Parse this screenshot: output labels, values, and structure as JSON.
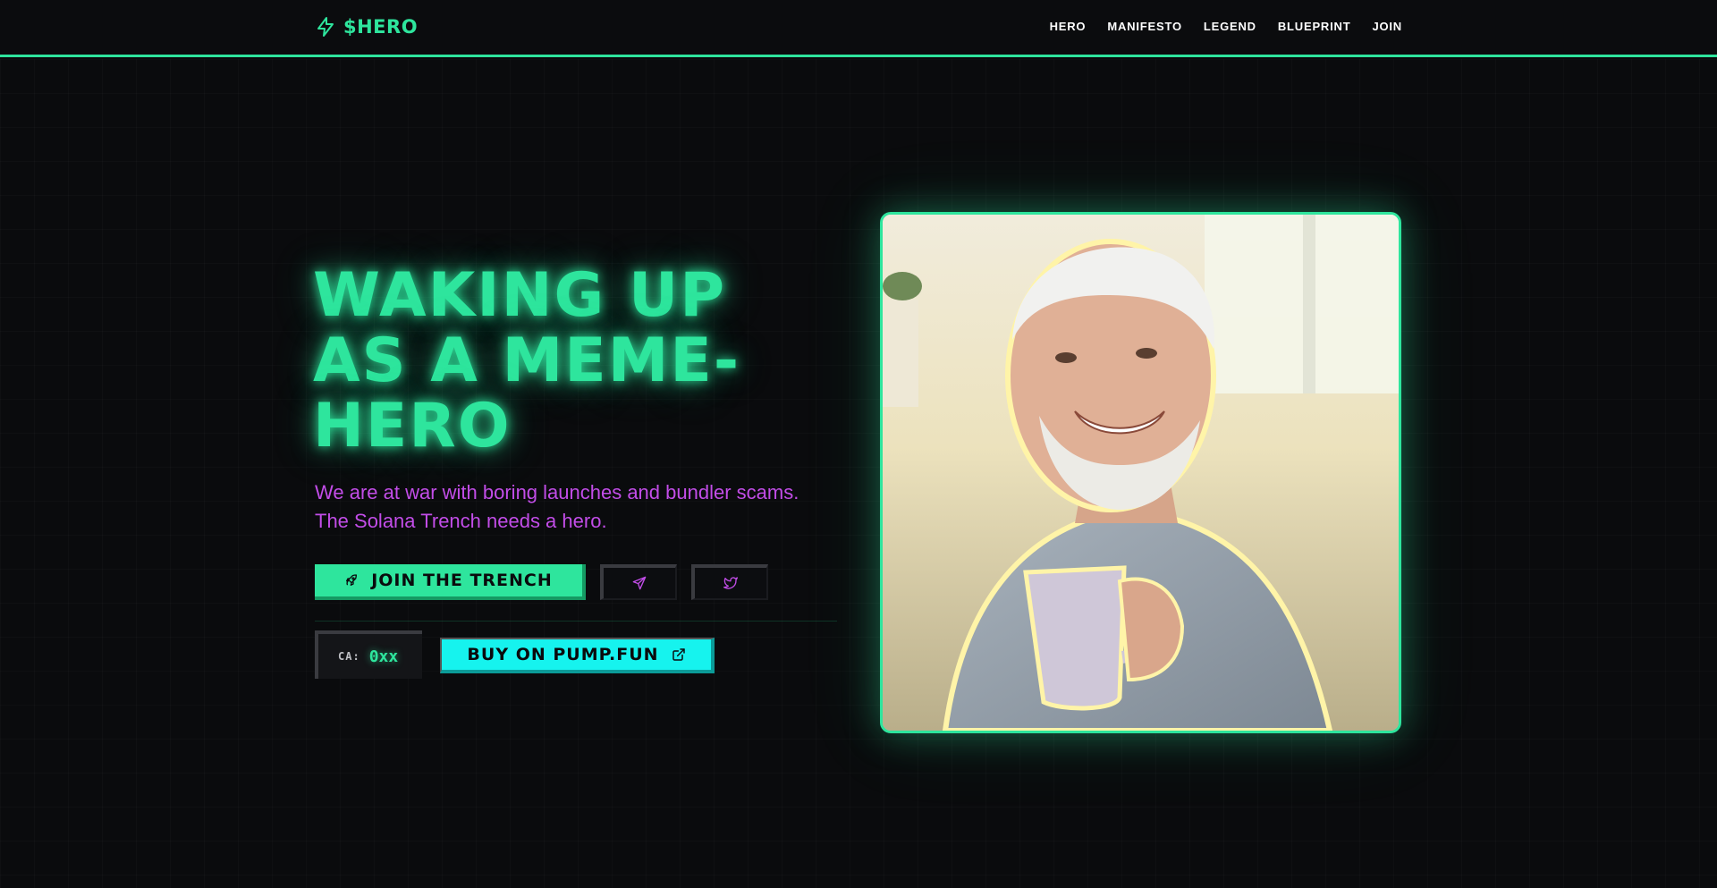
{
  "header": {
    "logo_text": "$HERO",
    "nav": [
      {
        "label": "HERO"
      },
      {
        "label": "MANIFESTO"
      },
      {
        "label": "LEGEND"
      },
      {
        "label": "BLUEPRINT"
      },
      {
        "label": "JOIN"
      }
    ]
  },
  "hero": {
    "title": "WAKING UP AS A MEME-HERO",
    "subtitle_lines": [
      "We are at war with boring launches and bundler scams.",
      "The Solana Trench needs a hero."
    ],
    "join_button_label": "JOIN THE TRENCH",
    "ca_label": "CA:",
    "ca_value": "0xx",
    "buy_button_label": "BUY ON PUMP.FUN"
  },
  "icons": {
    "logo": "lightning-icon",
    "join": "rocket-icon",
    "telegram": "telegram-icon",
    "twitter": "twitter-icon",
    "external": "external-link-icon"
  },
  "colors": {
    "accent_green": "#2ee59d",
    "accent_cyan": "#16f3ee",
    "accent_purple": "#c24de8",
    "background": "#0a0b0d"
  }
}
